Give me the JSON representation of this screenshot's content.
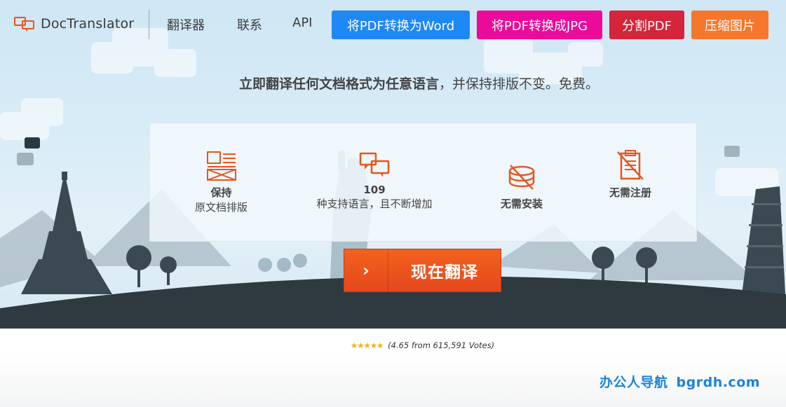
{
  "brand": {
    "name": "DocTranslator"
  },
  "nav": {
    "links": [
      "翻译器",
      "联系",
      "API"
    ],
    "buttons": [
      {
        "label": "将PDF转换为Word",
        "color": "#1e88f4"
      },
      {
        "label": "将PDF转换成JPG",
        "color": "#ec0a9a"
      },
      {
        "label": "分割PDF",
        "color": "#d4253a"
      },
      {
        "label": "压缩图片",
        "color": "#f6772c"
      }
    ]
  },
  "tagline": {
    "bold": "立即翻译任何文档格式为任意语言",
    "rest": "，并保持排版不变。免费。"
  },
  "features": [
    {
      "title": "保持",
      "subtitle": "原文档排版",
      "icon": "layout-icon"
    },
    {
      "title": "109",
      "subtitle": "种支持语言，且不断增加",
      "icon": "translate-icon"
    },
    {
      "title": "无需安装",
      "subtitle": "",
      "icon": "no-install-icon"
    },
    {
      "title": "无需注册",
      "subtitle": "",
      "icon": "no-register-icon"
    }
  ],
  "cta": {
    "arrow": "›",
    "label": "现在翻译"
  },
  "rating": {
    "stars": "★★★★★",
    "text": "(4.65 from 615,591 Votes)"
  },
  "watermark": {
    "name": "办公人导航",
    "domain": "bgrdh.com"
  },
  "colors": {
    "accent": "#e8561d",
    "icon": "#e8561d",
    "ground": "#2e3a40"
  }
}
